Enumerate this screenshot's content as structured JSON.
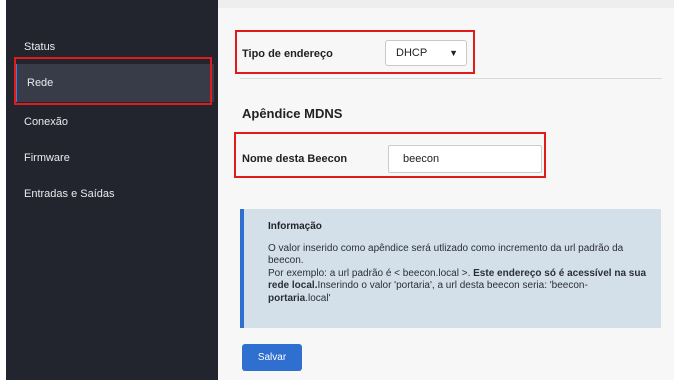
{
  "sidebar": {
    "items": [
      {
        "label": "Status"
      },
      {
        "label": "Rede"
      },
      {
        "label": "Conexão"
      },
      {
        "label": "Firmware"
      },
      {
        "label": "Entradas e Saídas"
      }
    ]
  },
  "network": {
    "address_type_label": "Tipo de endereço",
    "address_type_value": "DHCP",
    "section_title": "Apêndice MDNS",
    "device_name_label": "Nome desta Beecon",
    "device_name_value": "beecon"
  },
  "info": {
    "title": "Informação",
    "line1": "O valor inserido como apêndice será utlizado como incremento da url padrão da beecon.",
    "line2_start": "Por exemplo: a url padrão é < beecon.local >.",
    "line2_bold": "Este endereço só é acessível na sua rede local.",
    "line2_mid": "Inserindo o valor 'portaria', a url desta beecon seria: 'beecon-",
    "line2_bold2": "portaria",
    "line2_end": ".local'"
  },
  "actions": {
    "save_label": "Salvar"
  },
  "colors": {
    "sidebar_bg": "#22252d",
    "accent": "#2f6fd0",
    "highlight": "#e01b1b",
    "info_bg": "#d3dfe9"
  }
}
